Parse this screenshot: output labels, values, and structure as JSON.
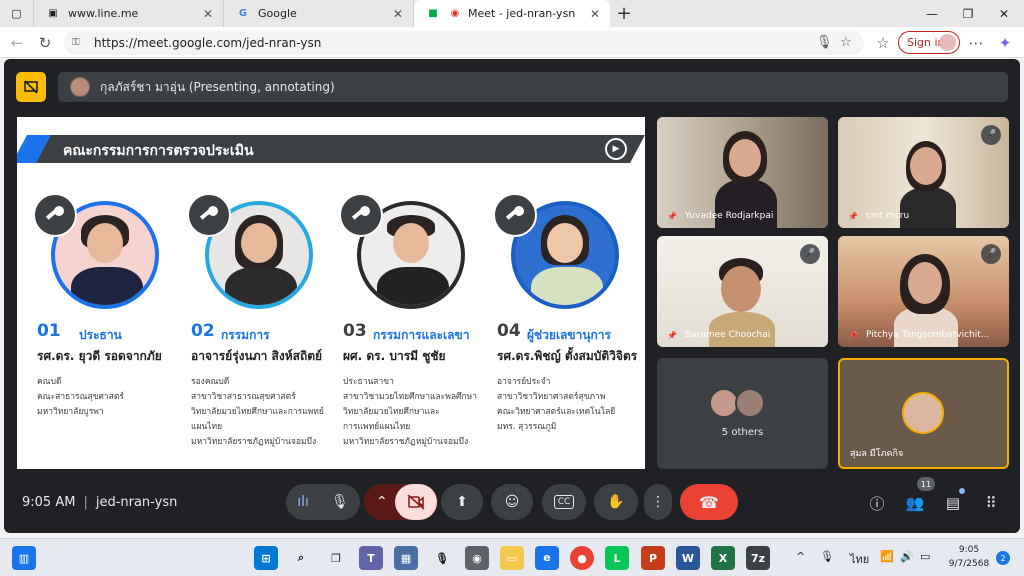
{
  "browser": {
    "tabs": [
      {
        "label": "www.line.me"
      },
      {
        "label": "Google"
      },
      {
        "label": "Meet - jed-nran-ysn"
      }
    ],
    "url": "https://meet.google.com/jed-nran-ysn",
    "sign_in": "Sign in",
    "colors": {
      "accent_red": "#c5221f",
      "tab_bg": "#e8e8e8"
    }
  },
  "meet": {
    "presenter_status": "กุลภัสร์ชา มาอุ่น (Presenting, annotating)",
    "time": "9:05 AM",
    "meeting_code": "jed-nran-ysn",
    "people_count": "11",
    "colors": {
      "hangup": "#ea4335",
      "presenting": "#fbbc04",
      "self_border": "#f9ab00"
    }
  },
  "slide": {
    "title": "คณะกรรมการการตรวจประเมิน",
    "members": [
      {
        "number": "01",
        "role": "ประธาน",
        "name": "รศ.ดร. ยุวดี รอดจากภัย",
        "desc": [
          "คณบดี",
          "คณะสาธารณสุขศาสตร์",
          "มหาวิทยาลัยบูรพา"
        ]
      },
      {
        "number": "02",
        "role": "กรรมการ",
        "name": "อาจารย์รุ่งนภา สิงห์สถิตย์",
        "desc": [
          "รองคณบดี",
          "สาขาวิชาสาธารณสุขศาสตร์",
          "วิทยาลัยมวยไทยศึกษาและการแพทย์",
          "แผนไทย",
          "มหาวิทยาลัยราชภัฏหมู่บ้านจอมบึง"
        ]
      },
      {
        "number": "03",
        "role": "กรรมการและเลขา",
        "name": "ผศ. ดร. บารมี  ชูชัย",
        "desc": [
          "ประธานสาขา",
          "สาขาวิชามวยไทยศึกษาและพลศึกษา",
          "วิทยาลัยมวยไทยศึกษาและ",
          "การแพทย์แผนไทย",
          "มหาวิทยาลัยราชภัฏหมู่บ้านจอมบึง"
        ]
      },
      {
        "number": "04",
        "role": "ผู้ช่วยเลขานุการ",
        "name": "รศ.ดร.พิชญ์ ตั้งสมบัติวิจิตร",
        "desc": [
          "อาจารย์ประจำ",
          "สาขาวิชาวิทยาศาสตร์สุขภาพ",
          "คณะวิทยาศาสตร์และเทคโนโลยี",
          "มทร. สุวรรณภูมิ"
        ]
      }
    ]
  },
  "participants": [
    {
      "name": "Yuvadee Rodjarkpai"
    },
    {
      "name": "cmt mcru"
    },
    {
      "name": "Baramee Choochai"
    },
    {
      "name": "Pitchya Tangsombatvichit..."
    },
    {
      "others": "5 others"
    },
    {
      "name": "สุมล มีโภคกิจ"
    }
  ],
  "taskbar": {
    "lang": "ไทย",
    "time": "9:05",
    "date": "9/7/2568",
    "notifications": "2"
  }
}
